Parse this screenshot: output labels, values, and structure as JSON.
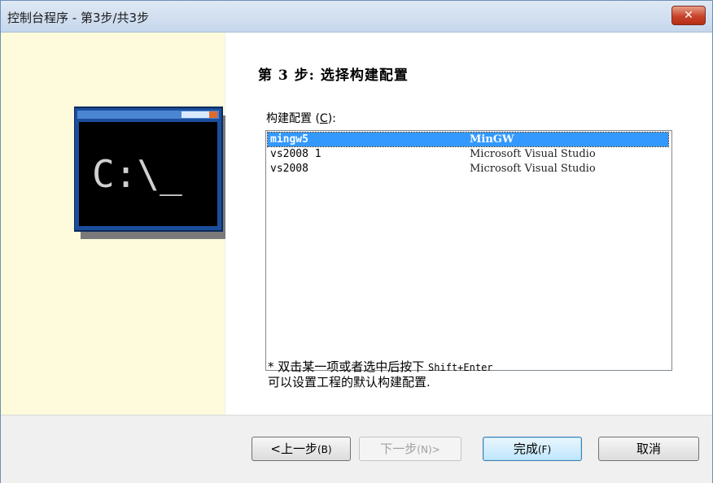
{
  "window": {
    "title": "控制台程序 - 第3步/共3步",
    "close_label": "✕"
  },
  "icon": {
    "prompt_text": "C:\\_"
  },
  "page": {
    "step_title": "第 3 步: 选择构建配置",
    "config_label": "构建配置",
    "config_accel": "C",
    "config_label_suffix": ":"
  },
  "list": {
    "rows": [
      {
        "name": "mingw5",
        "desc": "MinGW",
        "selected": true
      },
      {
        "name": "vs2008 1",
        "desc": "Microsoft Visual Studio",
        "selected": false
      },
      {
        "name": "vs2008",
        "desc": "Microsoft Visual Studio",
        "selected": false
      }
    ]
  },
  "note": {
    "line1_prefix": "* 双击某一项或者选中后按下 ",
    "line1_keys": "Shift+Enter",
    "line2": "可以设置工程的默认构建配置."
  },
  "buttons": {
    "back_label": "<上一步",
    "back_accel": "(B)",
    "next_label": "下一步",
    "next_accel": "(N)>",
    "finish_label": "完成",
    "finish_accel": "(F)",
    "cancel_label": "取消"
  },
  "colors": {
    "left_panel": "#fdfbdc",
    "selection": "#3399ff",
    "close": "#c7432a"
  }
}
